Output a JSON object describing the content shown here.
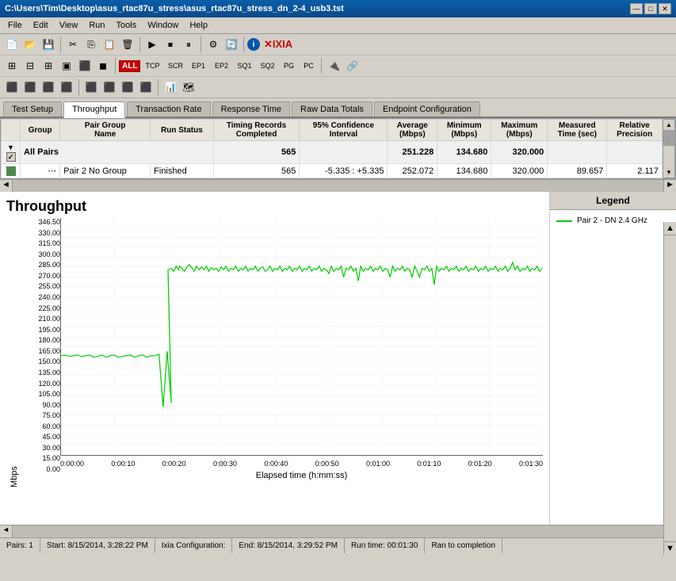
{
  "titleBar": {
    "text": "C:\\Users\\Tim\\Desktop\\asus_rtac87u_stress\\asus_rtac87u_stress_dn_2-4_usb3.tst",
    "minimize": "—",
    "maximize": "□",
    "close": "✕"
  },
  "menuBar": {
    "items": [
      "File",
      "Edit",
      "View",
      "Run",
      "Tools",
      "Window",
      "Help"
    ]
  },
  "toolbar2": {
    "allLabel": "ALL",
    "protocols": [
      "TCP",
      "SCR",
      "EP1",
      "EP2",
      "SQ1",
      "SQ2",
      "PG",
      "PC"
    ],
    "ixiaLabel": "IXIA"
  },
  "tabs": {
    "items": [
      "Test Setup",
      "Throughput",
      "Transaction Rate",
      "Response Time",
      "Raw Data Totals",
      "Endpoint Configuration"
    ],
    "active": 1
  },
  "tableHeaders": {
    "group": "Group",
    "pairGroupName": "Pair Group Name",
    "runStatus": "Run Status",
    "timingRecordsCompleted": "Timing Records Completed",
    "confidence95": "95% Confidence Interval",
    "averageMbps": "Average (Mbps)",
    "minimumMbps": "Minimum (Mbps)",
    "maximumMbps": "Maximum (Mbps)",
    "measuredTimeSec": "Measured Time (sec)",
    "relativePrecision": "Relative Precision"
  },
  "tableRows": {
    "allPairs": {
      "label": "All Pairs",
      "timingRecords": "565",
      "confidence": "",
      "average": "251.228",
      "minimum": "134.680",
      "maximum": "320.000",
      "measuredTime": "",
      "precision": ""
    },
    "pair2": {
      "pairGroupName": "Pair 2  No Group",
      "runStatus": "Finished",
      "timingRecords": "565",
      "confidence": "-5.335 : +5.335",
      "average": "252.072",
      "minimum": "134.680",
      "maximum": "320.000",
      "measuredTime": "89.657",
      "precision": "2.117"
    }
  },
  "chart": {
    "title": "Throughput",
    "yAxisLabel": "Mbps",
    "xAxisLabel": "Elapsed time (h:mm:ss)",
    "yTicks": [
      "346.50",
      "330.00",
      "315.00",
      "300.00",
      "285.00",
      "270.00",
      "255.00",
      "240.00",
      "225.00",
      "210.00",
      "195.00",
      "180.00",
      "165.00",
      "150.00",
      "135.00",
      "120.00",
      "105.00",
      "90.00",
      "75.00",
      "60.00",
      "45.00",
      "30.00",
      "15.00",
      "0.00"
    ],
    "xTicks": [
      "0:00:00",
      "0:00:10",
      "0:00:20",
      "0:00:30",
      "0:00:40",
      "0:00:50",
      "0:01:00",
      "0:01:10",
      "0:01:20",
      "0:01:30"
    ],
    "legend": {
      "title": "Legend",
      "items": [
        "Pair 2 - DN 2.4 GHz"
      ]
    }
  },
  "statusBar": {
    "pairs": "Pairs: 1",
    "start": "Start: 8/15/2014, 3:28:22 PM",
    "ixiaConfig": "Ixia Configuration:",
    "end": "End: 8/15/2014, 3:29:52 PM",
    "runtime": "Run time: 00:01:30",
    "completion": "Ran to completion"
  }
}
